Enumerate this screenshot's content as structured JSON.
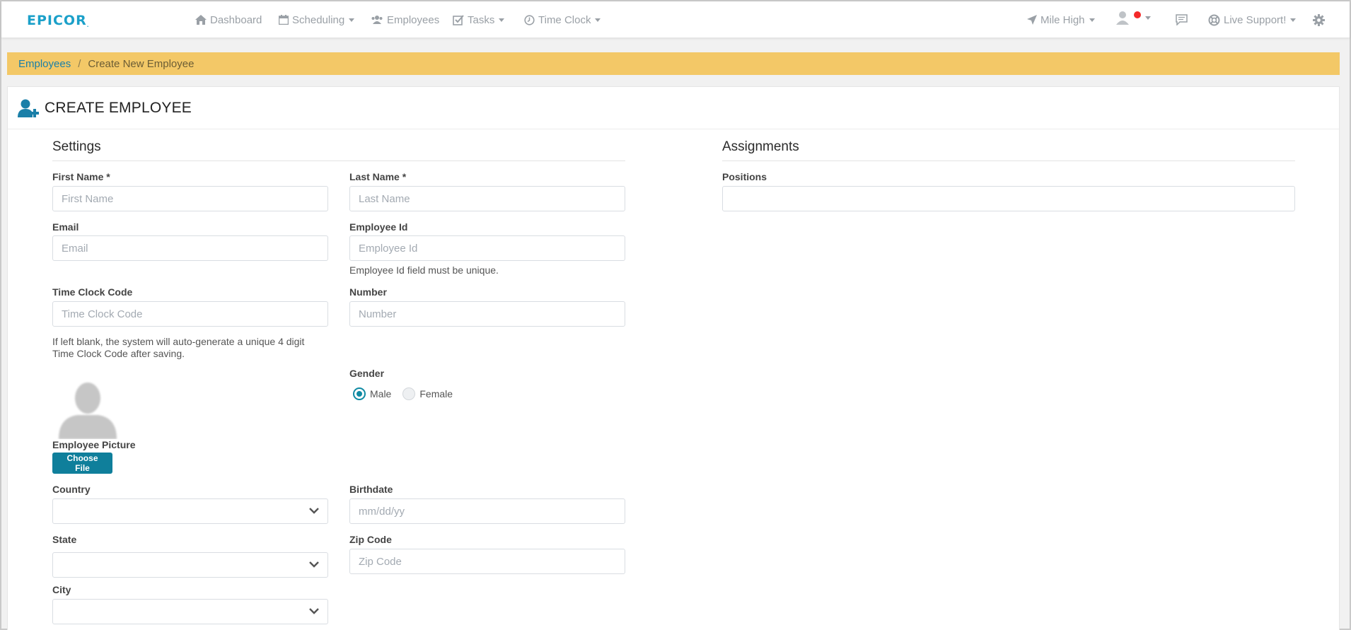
{
  "brand": {
    "logo_text": "EPICOR",
    "logo_mark": ".",
    "color": "#1ba0c9"
  },
  "nav": {
    "dashboard": "Dashboard",
    "scheduling": "Scheduling",
    "employees": "Employees",
    "tasks": "Tasks",
    "time_clock": "Time Clock",
    "location": "Mile High",
    "support": "Live Support!"
  },
  "breadcrumb": {
    "parent": "Employees",
    "separator": "/",
    "current": "Create New Employee"
  },
  "page": {
    "title": "CREATE EMPLOYEE"
  },
  "settings": {
    "title": "Settings",
    "first_name": {
      "label": "First Name *",
      "placeholder": "First Name"
    },
    "last_name": {
      "label": "Last Name *",
      "placeholder": "Last Name"
    },
    "email": {
      "label": "Email",
      "placeholder": "Email"
    },
    "employee_id": {
      "label": "Employee Id",
      "placeholder": "Employee Id",
      "help": "Employee Id field must be unique."
    },
    "time_clock_code": {
      "label": "Time Clock Code",
      "placeholder": "Time Clock Code",
      "help": "If left blank, the system will auto-generate a unique 4 digit Time Clock Code after saving."
    },
    "number": {
      "label": "Number",
      "placeholder": "Number"
    },
    "gender": {
      "label": "Gender",
      "options": [
        "Male",
        "Female"
      ],
      "selected": "Male"
    },
    "picture": {
      "label": "Employee Picture",
      "button": "Choose File"
    },
    "country": {
      "label": "Country",
      "value": ""
    },
    "birthdate": {
      "label": "Birthdate",
      "placeholder": "mm/dd/yy"
    },
    "state": {
      "label": "State",
      "value": ""
    },
    "zip": {
      "label": "Zip Code",
      "placeholder": "Zip Code"
    },
    "city": {
      "label": "City",
      "value": ""
    }
  },
  "assignments": {
    "title": "Assignments",
    "positions": {
      "label": "Positions",
      "value": ""
    }
  },
  "colors": {
    "accent": "#0f7f9b",
    "breadcrumb_bg": "#f3c867",
    "status_dot": "#f42a2a"
  }
}
